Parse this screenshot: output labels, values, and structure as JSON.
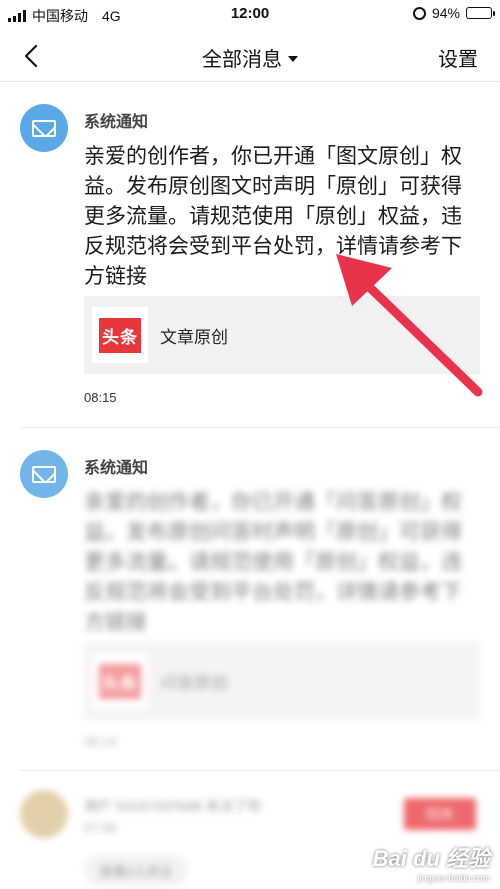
{
  "status_bar": {
    "carrier": "中国移动",
    "network": "4G",
    "time": "12:00",
    "battery": "94%",
    "battery_level": 0.94
  },
  "nav": {
    "title": "全部消息",
    "settings_label": "设置",
    "back_icon": "chevron-left-icon",
    "dropdown_icon": "caret-down-icon"
  },
  "messages": [
    {
      "sender": "系统通知",
      "avatar_icon": "envelope-icon",
      "text": "亲爱的创作者，你已开通「图文原创」权益。发布原创图文时声明「原创」可获得更多流量。请规范使用「原创」权益，违反规范将会受到平台处罚，详情请参考下方链接",
      "card": {
        "logo_text": "头条",
        "title": "文章原创"
      },
      "time": "08:15"
    },
    {
      "sender": "系统通知",
      "avatar_icon": "envelope-icon",
      "text": "亲爱的创作者，你已开通「问答原创」权益。发布原创问答时声明「原创」可获得更多流量。请规范使用「原创」权益，违反规范将会受到平台处罚，详情请参考下方链接",
      "card": {
        "logo_text": "头条",
        "title": "问答原创"
      },
      "time": "08:14"
    },
    {
      "sender": "用户 53167007648 关注了你",
      "time": "07:46",
      "button_label": "回关",
      "chip_label": "查看2人关注"
    }
  ],
  "colors": {
    "accent_red": "#e8363a",
    "avatar_blue": "#5aa9e6",
    "arrow_red": "#e8334a"
  },
  "watermark": {
    "main": "Bai du 经验",
    "sub": "jingyan.baidu.com"
  }
}
